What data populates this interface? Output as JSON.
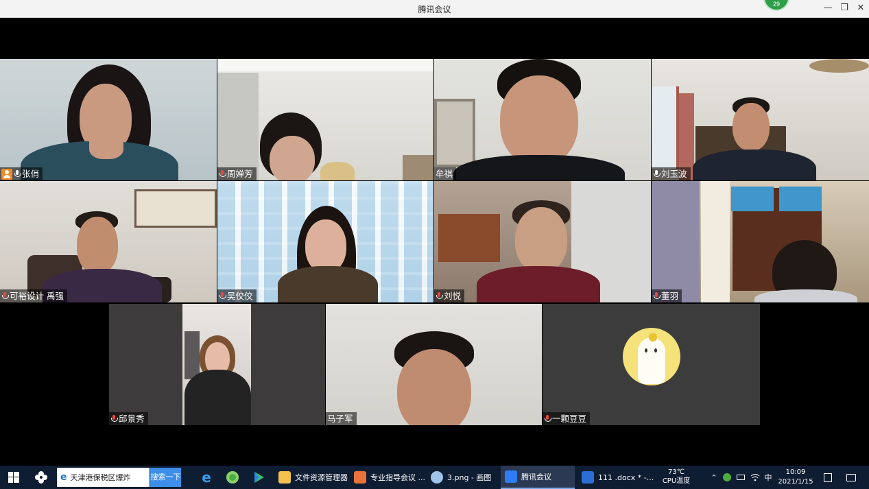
{
  "window": {
    "title": "腾讯会议",
    "participant_count": "29",
    "minimize": "—",
    "restore": "❐",
    "close": "✕"
  },
  "participants": [
    {
      "name": "张俏",
      "host": true
    },
    {
      "name": "周婵芳"
    },
    {
      "name": "牟祺"
    },
    {
      "name": "刘玉波"
    },
    {
      "name": "可裕设计 禹强"
    },
    {
      "name": "吴佼佼"
    },
    {
      "name": "刘悦"
    },
    {
      "name": "董羽"
    },
    {
      "name": "邱景秀"
    },
    {
      "name": "马子军"
    },
    {
      "name": "一颗豆豆"
    }
  ],
  "taskbar": {
    "search_text": "天津港保税区爆炸",
    "search_button": "搜索一下",
    "apps": [
      {
        "label": "文件资源管理器",
        "icon": "folder-icon",
        "color": "#f2c14e"
      },
      {
        "label": "专业指导会议 ...",
        "icon": "powerpoint-icon",
        "color": "#e8743b"
      },
      {
        "label": "3.png - 画图",
        "icon": "paint-icon",
        "color": "#9ec3e6"
      },
      {
        "label": "腾讯会议",
        "icon": "tencent-meeting-icon",
        "color": "#2e7cf6"
      },
      {
        "label": "111 .docx * -...",
        "icon": "wps-writer-icon",
        "color": "#2b6fd6"
      }
    ],
    "cpu_temp": "73℃",
    "cpu_label": "CPU温度",
    "ime": "中",
    "time": "10:09",
    "date": "2021/1/15"
  }
}
